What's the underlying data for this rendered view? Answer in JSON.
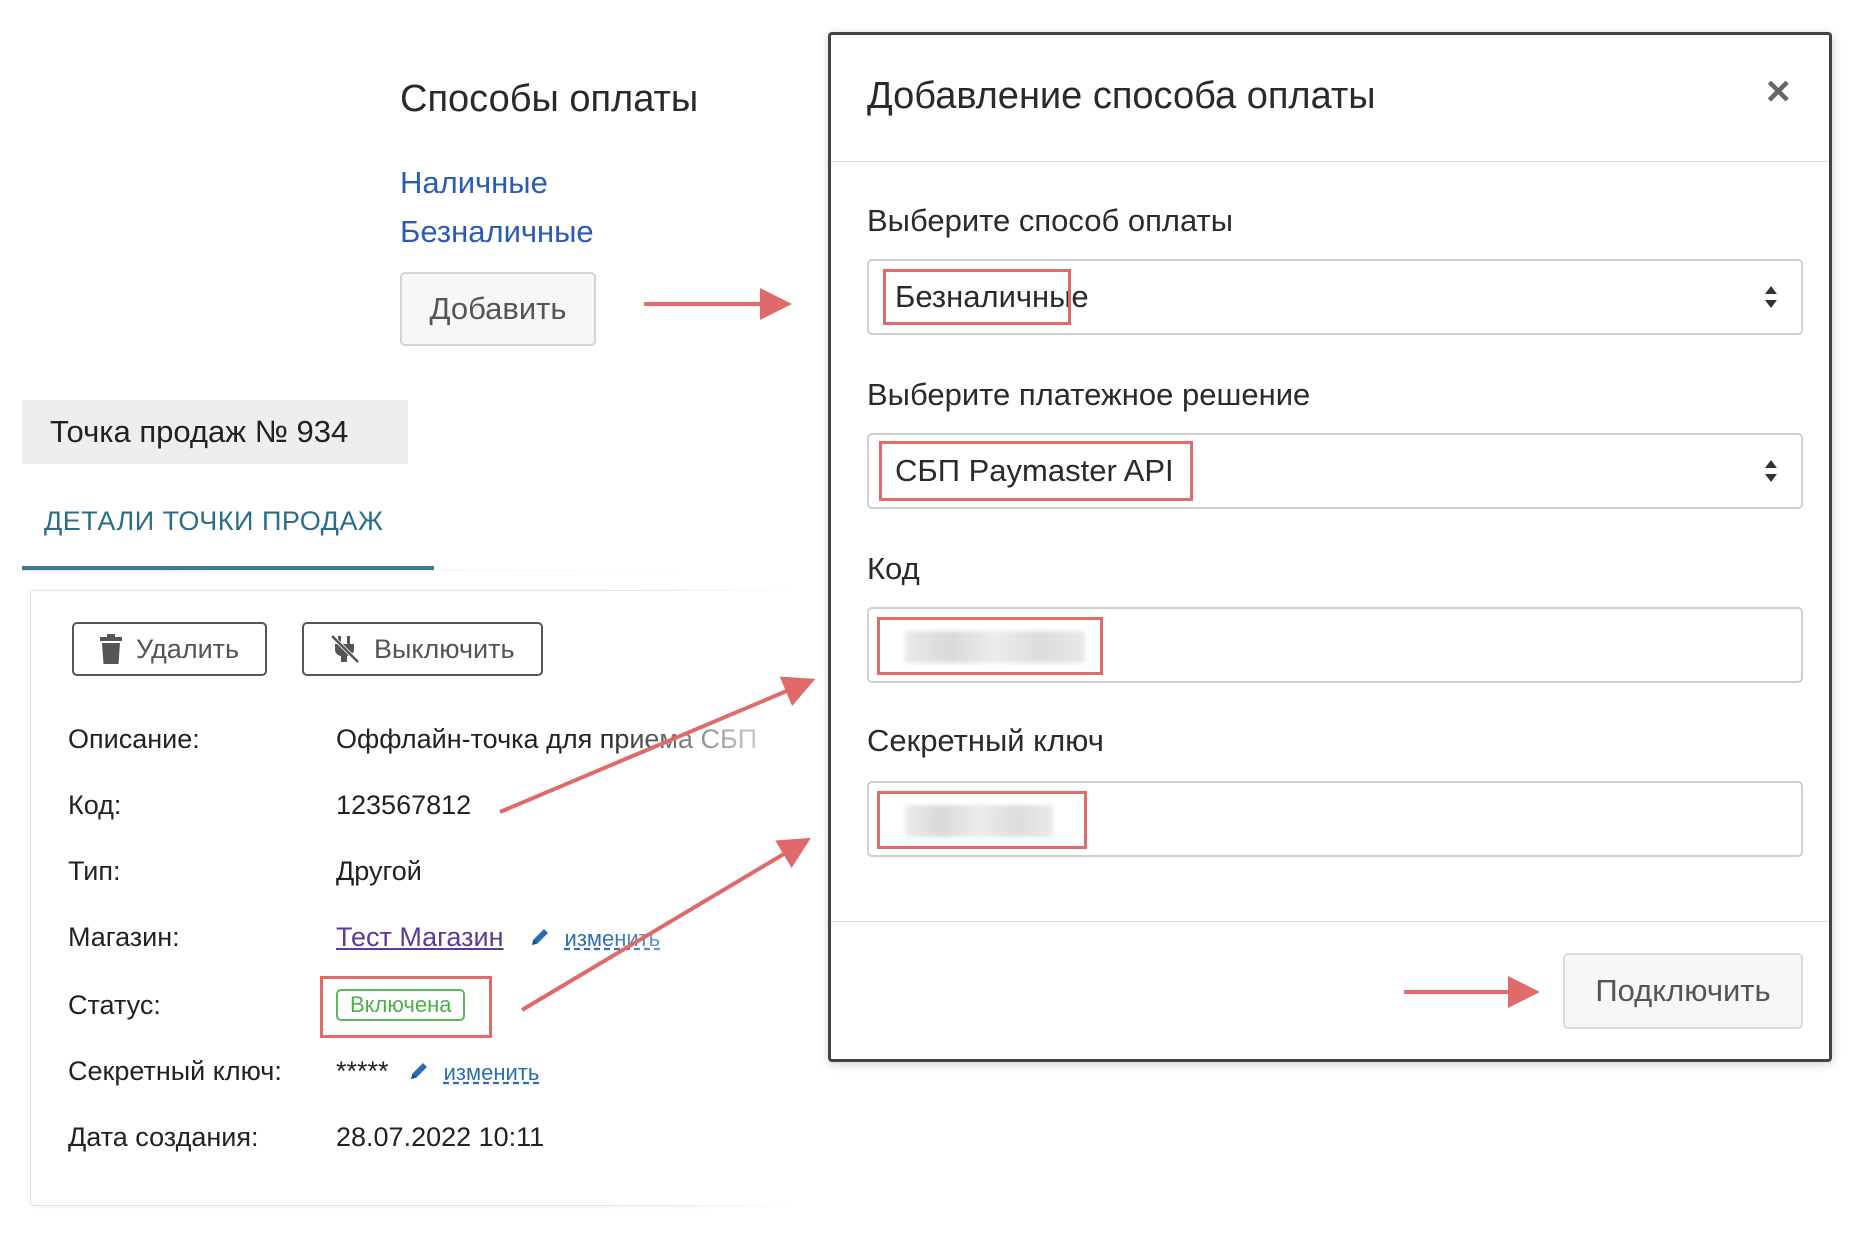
{
  "payment_methods": {
    "title": "Способы оплаты",
    "links": [
      "Наличные",
      "Безналичные"
    ],
    "add_button": "Добавить"
  },
  "point_of_sale": {
    "tab_label": "Точка продаж № 934",
    "details_tab": "ДЕТАЛИ ТОЧКИ ПРОДАЖ",
    "delete_button": "Удалить",
    "disable_button": "Выключить",
    "fields": {
      "description_label": "Описание:",
      "description_value": "Оффлайн-точка для приема СБП",
      "code_label": "Код:",
      "code_value": "123567812",
      "type_label": "Тип:",
      "type_value": "Другой",
      "store_label": "Магазин:",
      "store_value": "Тест Магазин",
      "store_edit": "изменить",
      "status_label": "Статус:",
      "status_value": "Включена",
      "secret_label": "Секретный ключ:",
      "secret_value": "*****",
      "secret_edit": "изменить",
      "created_label": "Дата создания:",
      "created_value": "28.07.2022 10:11"
    }
  },
  "modal": {
    "title": "Добавление способа оплаты",
    "close_icon": "×",
    "payment_method_label": "Выберите способ оплаты",
    "payment_method_value": "Безналичные",
    "payment_solution_label": "Выберите платежное решение",
    "payment_solution_value": "СБП Paymaster API",
    "code_label": "Код",
    "secret_label": "Секретный ключ",
    "connect_button": "Подключить"
  },
  "colors": {
    "annotation_red": "#e06a6a",
    "link_blue": "#2a5bb5",
    "status_green": "#4cae4c",
    "tab_teal": "#2a6d8a"
  },
  "icons": [
    "trash-icon",
    "unplug-icon",
    "pencil-icon",
    "close-icon",
    "select-arrows-icon"
  ]
}
